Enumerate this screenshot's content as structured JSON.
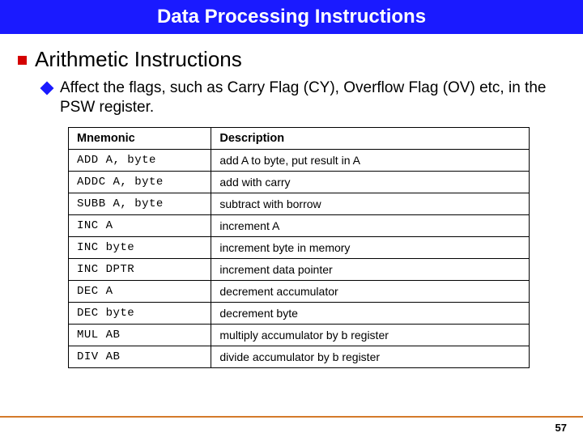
{
  "title": "Data Processing Instructions",
  "heading": "Arithmetic Instructions",
  "subtext": "Affect the flags, such as Carry Flag (CY), Overflow Flag (OV) etc,  in the PSW register.",
  "table": {
    "headers": {
      "mnemonic": "Mnemonic",
      "description": "Description"
    },
    "rows": [
      {
        "mnemonic": "ADD A, byte",
        "description": "add A to byte, put result in A"
      },
      {
        "mnemonic": "ADDC A, byte",
        "description": "add with carry"
      },
      {
        "mnemonic": "SUBB A, byte",
        "description": "subtract with borrow"
      },
      {
        "mnemonic": "INC A",
        "description": "increment A"
      },
      {
        "mnemonic": "INC byte",
        "description": "increment byte in memory"
      },
      {
        "mnemonic": "INC DPTR",
        "description": "increment data pointer"
      },
      {
        "mnemonic": "DEC A",
        "description": "decrement accumulator"
      },
      {
        "mnemonic": "DEC byte",
        "description": "decrement byte"
      },
      {
        "mnemonic": "MUL AB",
        "description": "multiply accumulator by b register"
      },
      {
        "mnemonic": "DIV AB",
        "description": "divide accumulator by b register"
      }
    ]
  },
  "page_number": "57"
}
